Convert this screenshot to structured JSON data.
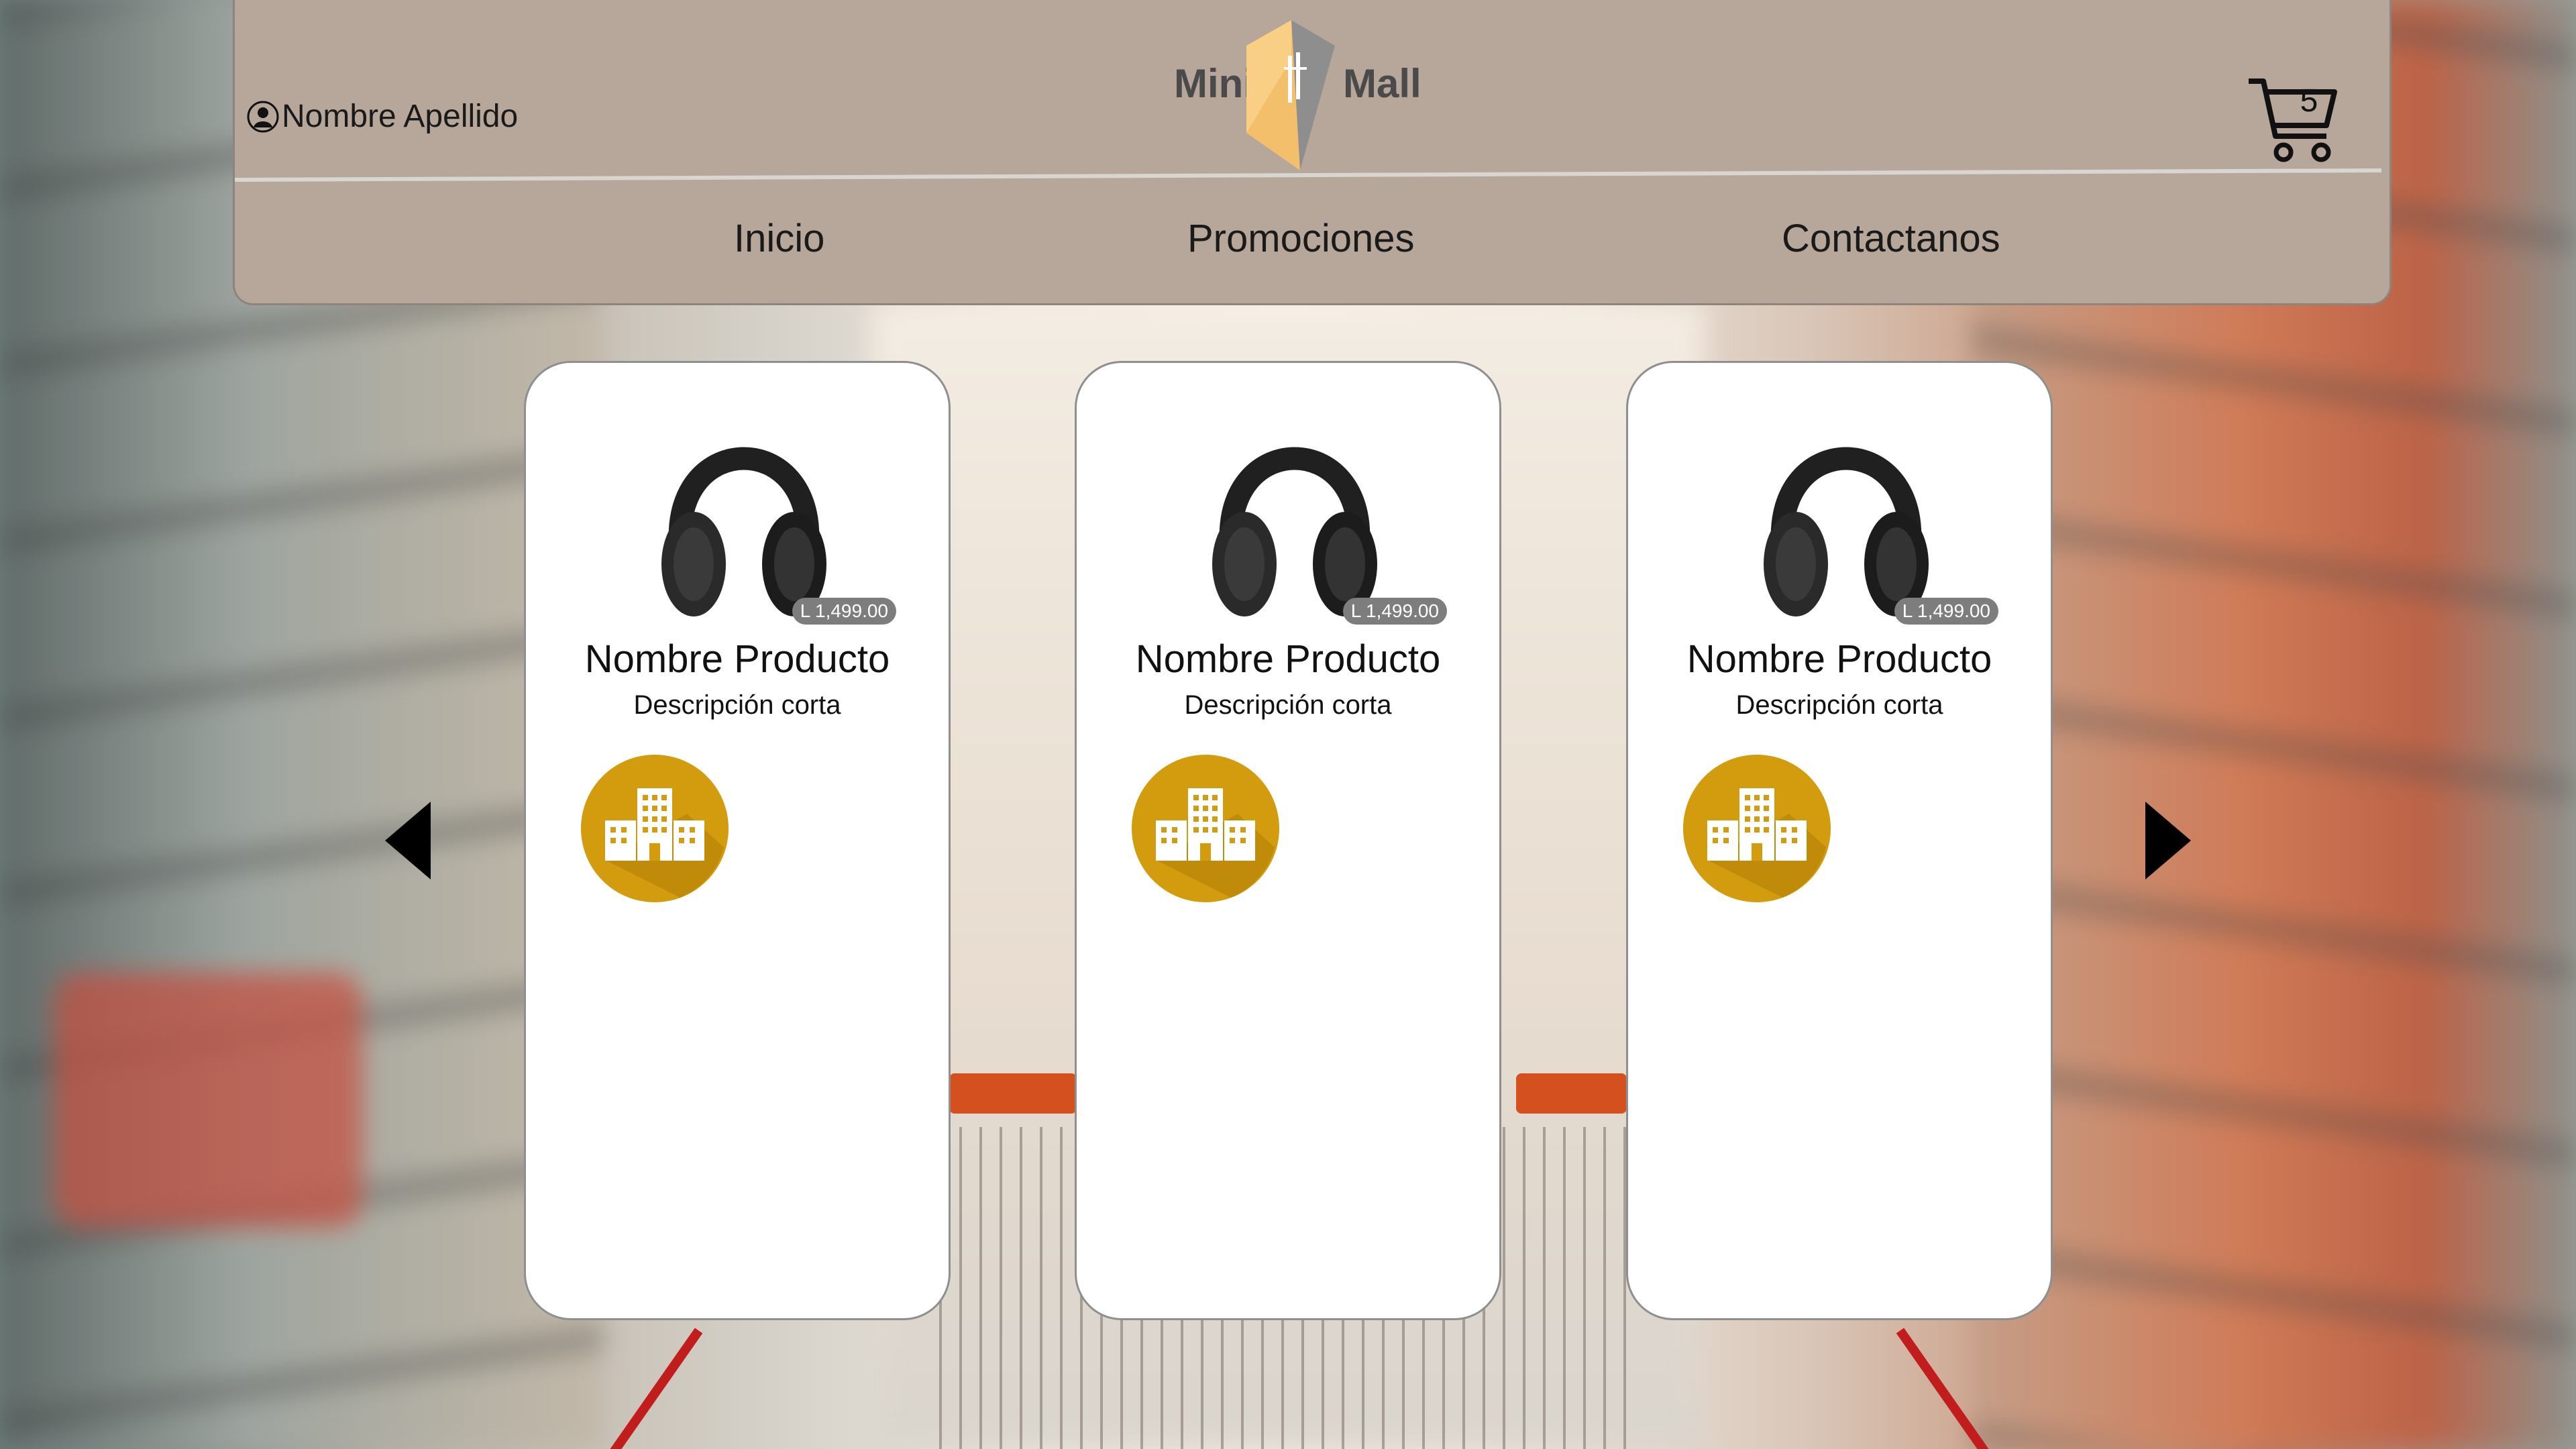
{
  "header": {
    "user_name": "Nombre Apellido",
    "logo": {
      "left": "Mini",
      "right": "Mall"
    },
    "nav": [
      "Inicio",
      "Promociones",
      "Contactanos"
    ],
    "cart_count": "5"
  },
  "products": [
    {
      "name": "Nombre Producto",
      "description": "Descripción corta",
      "price": "L 1,499.00",
      "store_icon": "buildings-icon",
      "image_icon": "headphones-icon"
    },
    {
      "name": "Nombre Producto",
      "description": "Descripción corta",
      "price": "L 1,499.00",
      "store_icon": "buildings-icon",
      "image_icon": "headphones-icon"
    },
    {
      "name": "Nombre Producto",
      "description": "Descripción corta",
      "price": "L 1,499.00",
      "store_icon": "buildings-icon",
      "image_icon": "headphones-icon"
    }
  ],
  "colors": {
    "header_bg": "#b7a79b",
    "store_badge": "#d39c0f",
    "price_tag": "#7d7d7d"
  },
  "carousel": {
    "prev_icon": "chevron-left-icon",
    "next_icon": "chevron-right-icon"
  }
}
